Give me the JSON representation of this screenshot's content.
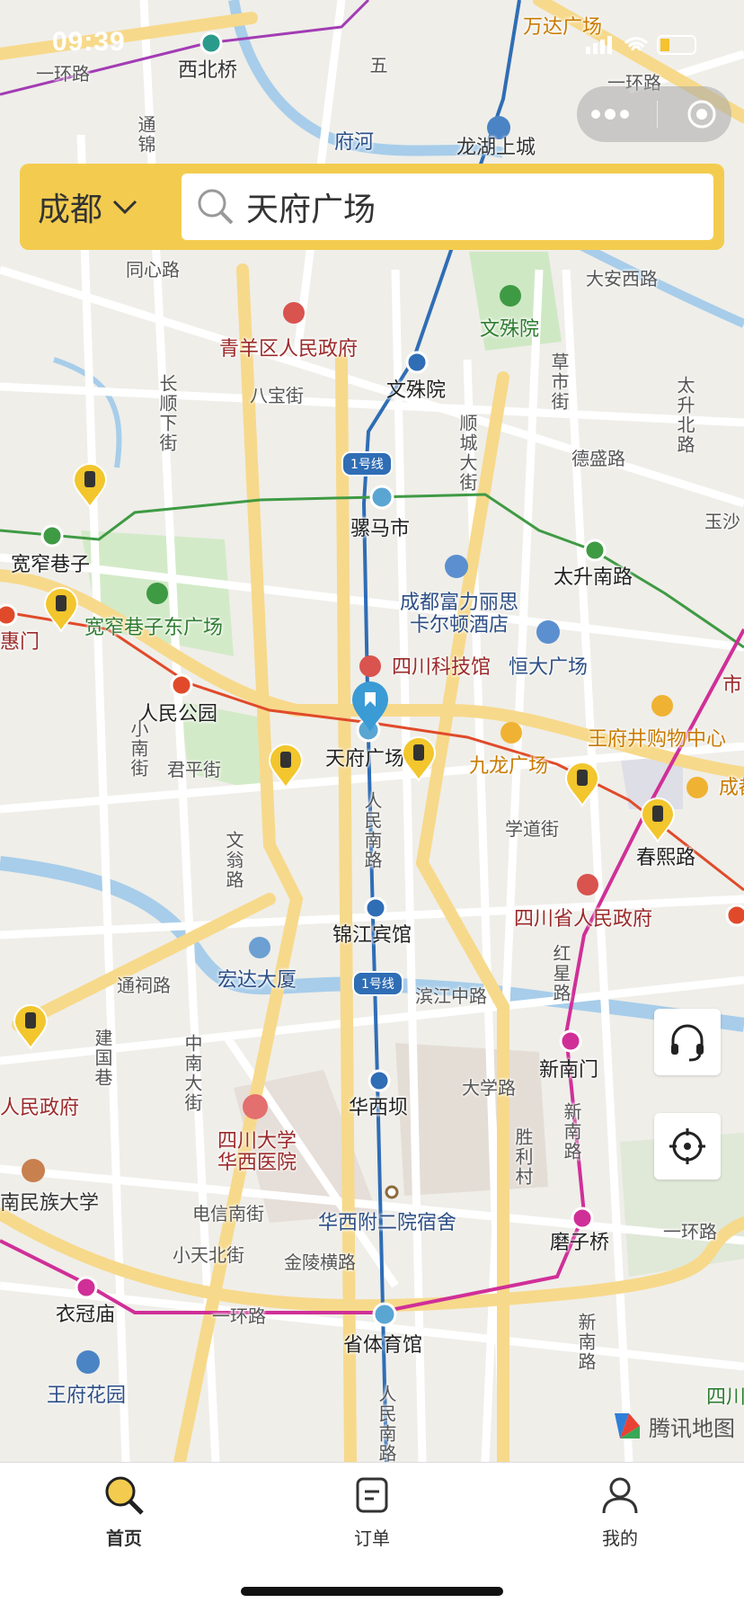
{
  "status": {
    "time": "09:39"
  },
  "search": {
    "city": "成都",
    "query": "天府广场"
  },
  "map_labels": {
    "xibeiqiao": "西北桥",
    "yihuanlu_tl": "一环路",
    "tongjin": "通锦",
    "wuzhi": "五",
    "fuhe": "府河",
    "wandaguangchang": "万达广场",
    "longhushangcheng": "龙湖上城",
    "yihuanlu_tr": "一环路",
    "xinxiang": "同心路",
    "qingyangqu": "青羊区人民政府",
    "wenshuyuan_park": "文殊院",
    "wenshuyuan_st": "文殊院",
    "daanxilu": "大安西路",
    "caoshi": "草市街",
    "taisheng": "太升北路",
    "changshun": "长顺下街",
    "babao": "八宝街",
    "shuncheng": "顺城大街",
    "desheng": "德盛路",
    "yusha": "玉沙",
    "line1": "1号线",
    "luomashi": "骡马市",
    "kuanzhaixiangzi": "宽窄巷子",
    "kuanzhai_dong": "宽窄巷子东广场",
    "taishengnanlu": "太升南路",
    "fuli": "成都富力丽思卡尔顿酒店",
    "huimen": "惠门",
    "sichuankejiguan": "四川科技馆",
    "hengda": "恒大广场",
    "renmingongyuan": "人民公园",
    "shi": "市",
    "wangfujing": "王府井购物中心",
    "tianfuguangchang": "天府广场",
    "jiulong": "九龙广场",
    "cheng": "成都",
    "xiaonan": "小南街",
    "junping": "君平街",
    "xuedao": "学道街",
    "chunxilu": "春熙路",
    "renminnan": "人民南路",
    "wenweng": "文翁路",
    "jianzhi": "锦江宾馆",
    "shengzhengfu": "四川省人民政府",
    "hongxing": "红星路",
    "binjiang": "滨江中路",
    "hongda": "宏达大厦",
    "line1b": "1号线",
    "tonghe": "通祠路",
    "jianguo": "建国巷",
    "xinnanmen": "新南门",
    "daxue": "大学路",
    "huaxiba": "华西坝",
    "zhongnan": "中南大街",
    "sichuandaxue": "四川大学华西医院",
    "shenglicun": "胜利村",
    "xinnanlu": "新南路",
    "renminzhengfu_l": "人民政府",
    "minzudaxue": "南民族大学",
    "dianxin": "电信南街",
    "huaxifu": "华西附二院宿舍",
    "mozhiqiao": "磨子桥",
    "xiaotian": "小天北街",
    "jinling": "金陵横路",
    "yihuanlu_b": "一环路",
    "yihuanlu_br": "一环路",
    "yiguanmiao": "衣冠庙",
    "shengtiyuguan": "省体育馆",
    "xinnanlu_b": "新南路",
    "wangfuhuayuan": "王府花园",
    "renminnan_b": "人民南路",
    "sichuan_br": "四川",
    "tencent": "腾讯地图"
  },
  "tabs": [
    {
      "label": "首页"
    },
    {
      "label": "订单"
    },
    {
      "label": "我的"
    }
  ]
}
